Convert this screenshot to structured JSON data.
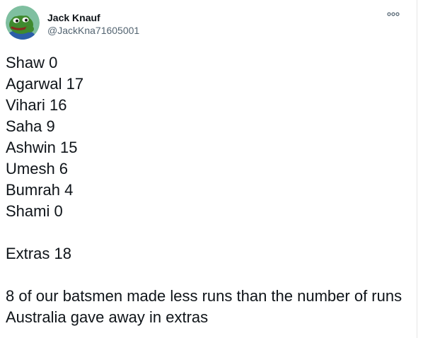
{
  "author": {
    "display_name": "Jack Knauf",
    "handle": "@JackKna71605001",
    "avatar_icon": "frog-avatar-icon"
  },
  "menu": {
    "icon": "more-options-icon"
  },
  "tweet": {
    "lines": [
      "Shaw 0",
      "Agarwal 17",
      "Vihari 16",
      "Saha 9",
      "Ashwin 15",
      "Umesh 6",
      "Bumrah 4",
      "Shami 0"
    ],
    "extras": "Extras 18",
    "closing": "8 of our batsmen made less runs than the number of runs Australia gave away in extras"
  },
  "colors": {
    "text": "#0f1419",
    "secondary": "#536471",
    "avatar_bg": "#7fbfa0",
    "frog_green": "#3f8a2e"
  }
}
